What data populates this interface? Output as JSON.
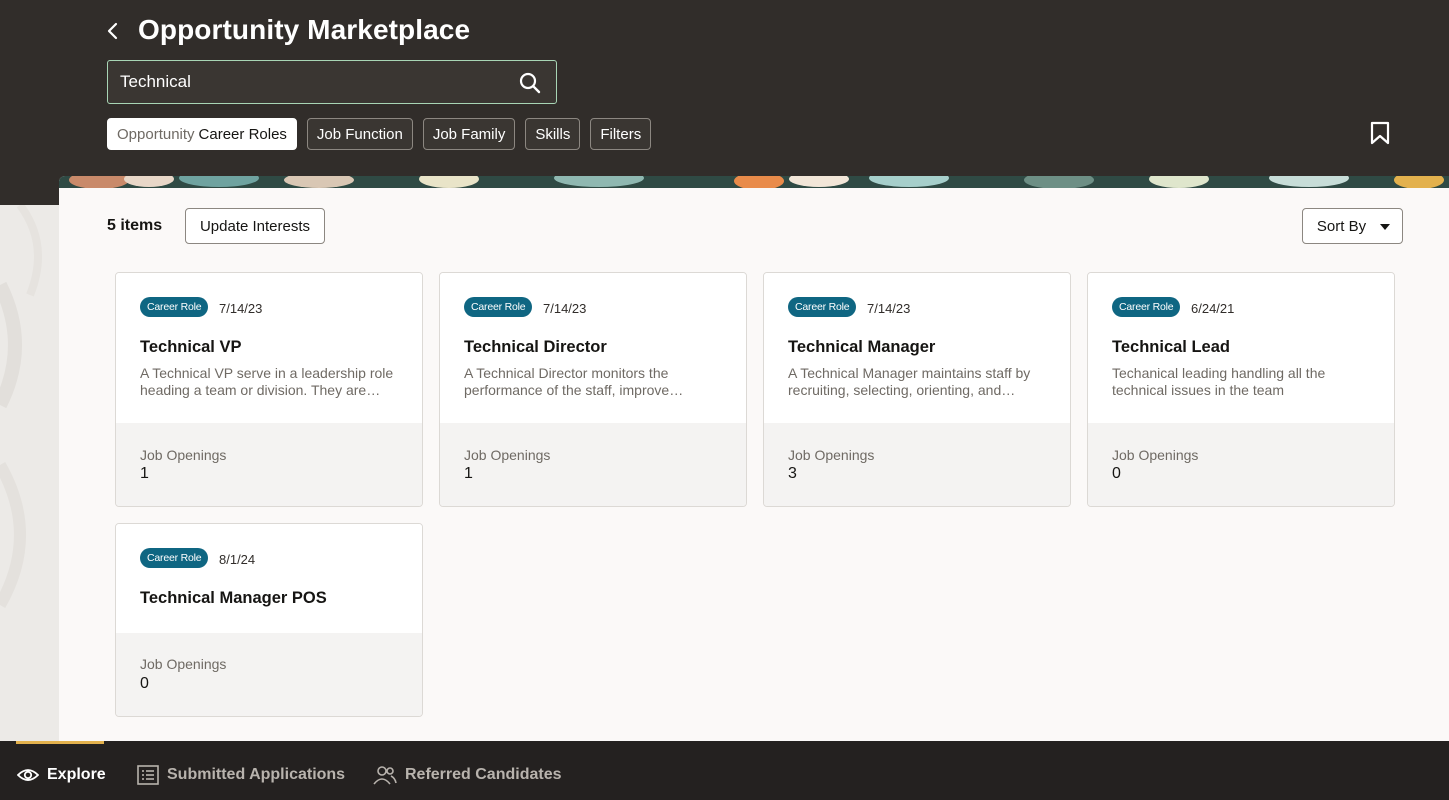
{
  "header": {
    "title": "Opportunity Marketplace",
    "back_icon": "chevron-left-icon",
    "search": {
      "value": "Technical",
      "placeholder": ""
    },
    "search_icon": "search-icon",
    "bookmark_icon": "bookmark-icon",
    "chips": [
      {
        "prefix": "Opportunity",
        "label": "Career Roles",
        "selected": true
      },
      {
        "label": "Job Function",
        "selected": false
      },
      {
        "label": "Job Family",
        "selected": false
      },
      {
        "label": "Skills",
        "selected": false
      },
      {
        "label": "Filters",
        "selected": false
      }
    ]
  },
  "results": {
    "count_label": "5 items",
    "update_button": "Update Interests",
    "sort_button": "Sort By"
  },
  "cards": [
    {
      "badge": "Career Role",
      "date": "7/14/23",
      "title": "Technical VP",
      "description": "A Technical VP serve in a leadership role heading a team or division. They are responsible for overseeing technical operations.",
      "openings_label": "Job Openings",
      "openings": "1"
    },
    {
      "badge": "Career Role",
      "date": "7/14/23",
      "title": "Technical Director",
      "description": "A Technical Director monitors the performance of the staff, improve processes and technical standards.",
      "openings_label": "Job Openings",
      "openings": "1"
    },
    {
      "badge": "Career Role",
      "date": "7/14/23",
      "title": "Technical Manager",
      "description": "A Technical Manager maintains staff by recruiting, selecting, orienting, and training employees.",
      "openings_label": "Job Openings",
      "openings": "3"
    },
    {
      "badge": "Career Role",
      "date": "6/24/21",
      "title": "Technical Lead",
      "description": "Techanical leading handling all the technical issues in the team",
      "openings_label": "Job Openings",
      "openings": "0"
    },
    {
      "badge": "Career Role",
      "date": "8/1/24",
      "title": "Technical Manager POS",
      "description": "",
      "openings_label": "Job Openings",
      "openings": "0"
    }
  ],
  "bottom_nav": [
    {
      "label": "Explore",
      "icon": "eye-icon",
      "active": true
    },
    {
      "label": "Submitted Applications",
      "icon": "list-icon",
      "active": false
    },
    {
      "label": "Referred Candidates",
      "icon": "users-icon",
      "active": false
    }
  ],
  "colors": {
    "header_bg": "#312d2a",
    "badge_bg": "#0f6682",
    "nav_indicator": "#e3b14d",
    "search_border": "#a8d5b5"
  }
}
